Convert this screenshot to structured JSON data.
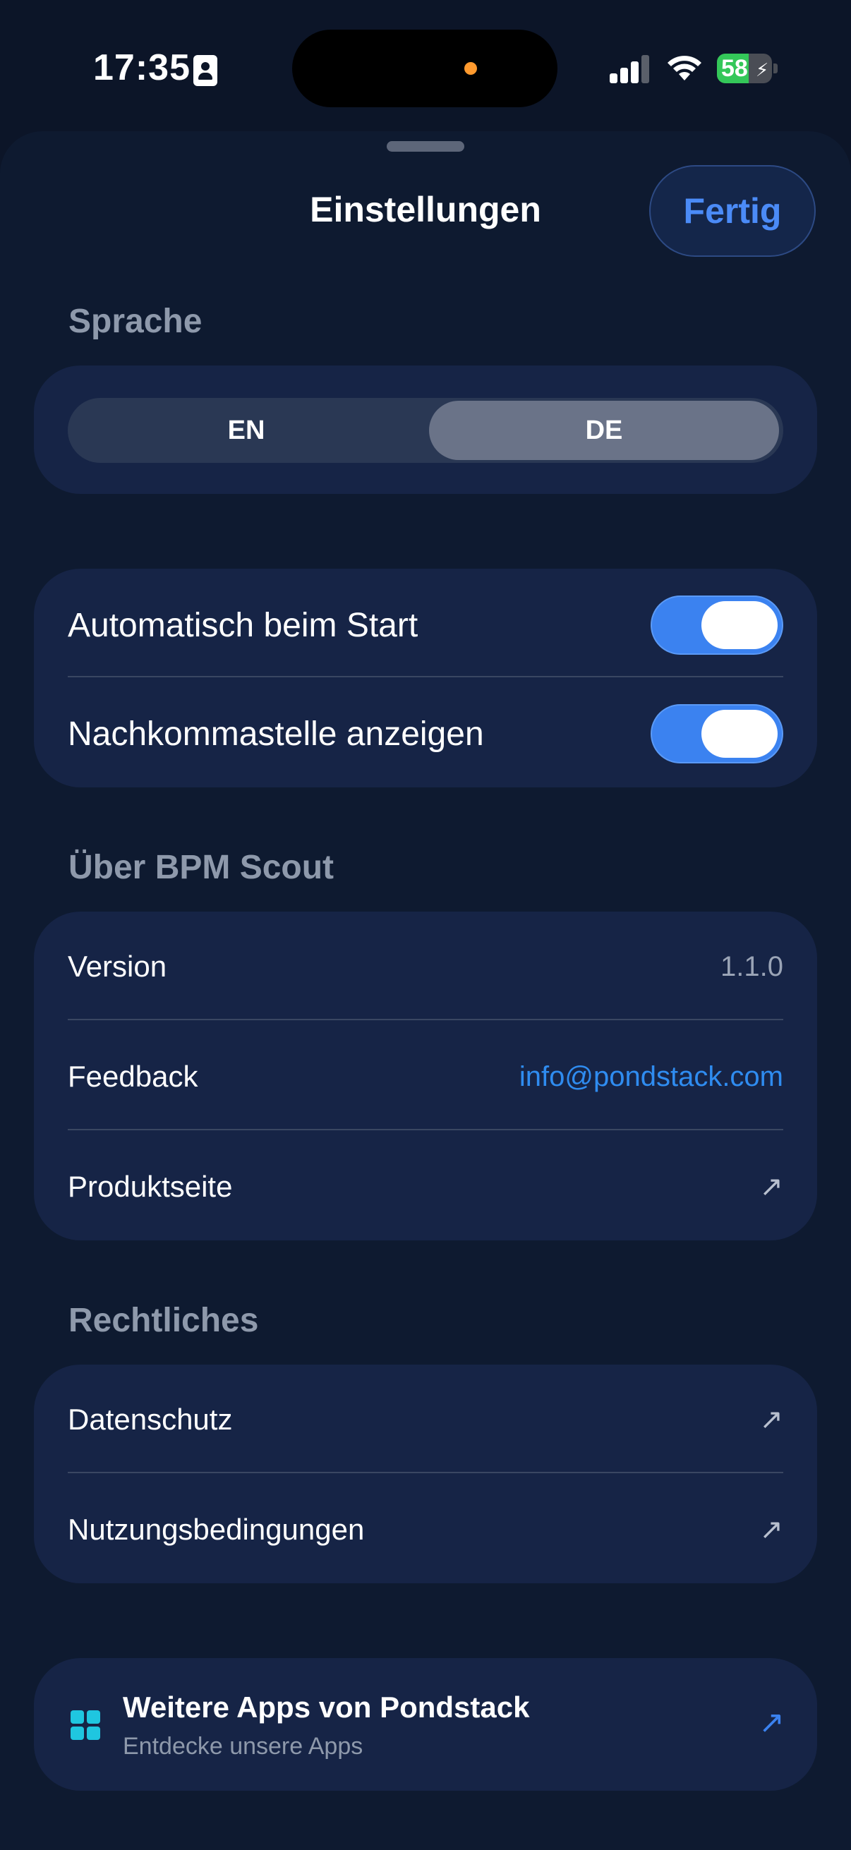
{
  "status_bar": {
    "time": "17:35",
    "battery_level": "58",
    "battery_fraction": 0.58,
    "icons": [
      "contact-card-icon",
      "signal-icon",
      "wifi-icon",
      "battery-icon",
      "charging-bolt-icon"
    ]
  },
  "header": {
    "title": "Einstellungen",
    "done_label": "Fertig"
  },
  "language": {
    "section_label": "Sprache",
    "options": [
      "EN",
      "DE"
    ],
    "selected": "DE"
  },
  "toggles": [
    {
      "label": "Automatisch beim Start",
      "on": true
    },
    {
      "label": "Nachkommastelle anzeigen",
      "on": true
    }
  ],
  "about": {
    "section_label": "Über BPM Scout",
    "version_label": "Version",
    "version_value": "1.1.0",
    "feedback_label": "Feedback",
    "feedback_value": "info@pondstack.com",
    "product_label": "Produktseite"
  },
  "legal": {
    "section_label": "Rechtliches",
    "privacy_label": "Datenschutz",
    "terms_label": "Nutzungsbedingungen"
  },
  "more_apps": {
    "title": "Weitere Apps von Pondstack",
    "subtitle": "Entdecke unsere Apps"
  },
  "colors": {
    "background": "#0c1528",
    "card": "#162446",
    "accent": "#3b82f0",
    "link": "#2f8cf0",
    "section_label": "#8e99ab"
  }
}
